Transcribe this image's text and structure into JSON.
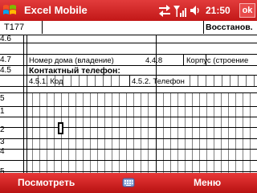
{
  "title_bar": {
    "app_title": "Excel Mobile",
    "clock": "21:50",
    "ok_label": "ok"
  },
  "toolbar": {
    "cell_ref": "T177",
    "formula": "",
    "restore_label": "Восстанов."
  },
  "rows": [
    {
      "header": "4.6"
    },
    {
      "header": "4.7",
      "cells": [
        "Номер дома (владение)",
        "4.4.8",
        "Корпус (строение"
      ]
    },
    {
      "header": "4.5",
      "cells": [
        "Контактный телефон:"
      ]
    },
    {
      "header": "",
      "cells": [
        "4.5.1. Код",
        "4.5.2. Телефон"
      ]
    },
    {
      "header": ""
    },
    {
      "header": "5"
    },
    {
      "header": ""
    },
    {
      "header": "1"
    },
    {
      "header": "2"
    },
    {
      "header": "3"
    },
    {
      "header": "4"
    },
    {
      "header": ""
    },
    {
      "header": "5"
    }
  ],
  "menu": {
    "left_label": "Посмотреть",
    "right_label": "Меню"
  }
}
